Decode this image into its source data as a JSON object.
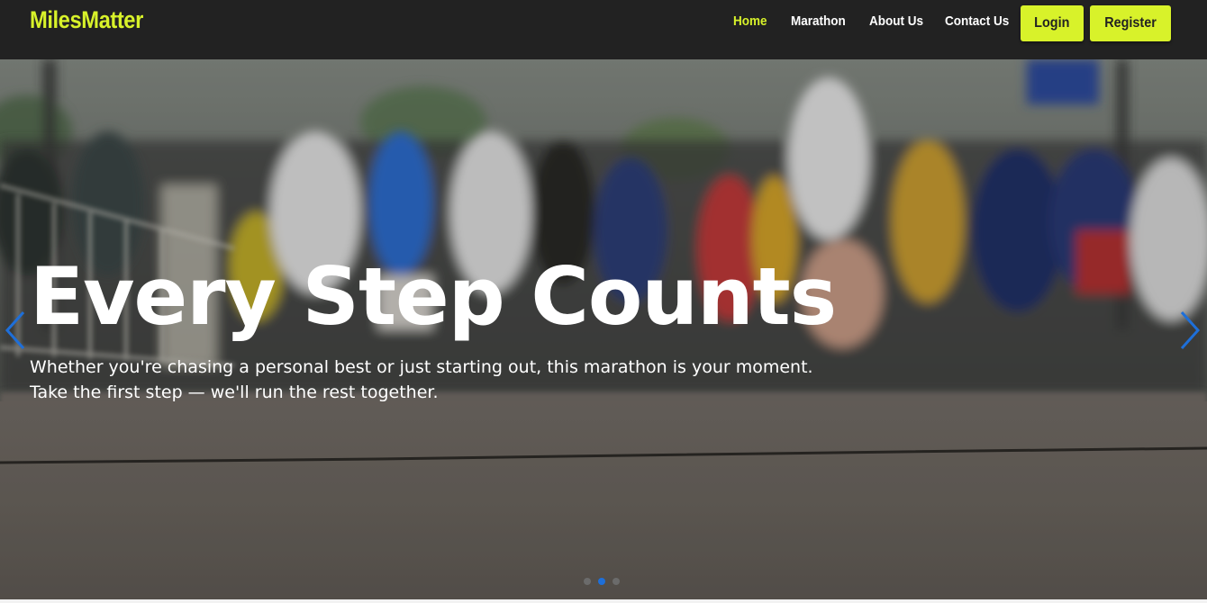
{
  "navbar": {
    "brand": "MilesMatter",
    "links": [
      {
        "label": "Home",
        "active": true
      },
      {
        "label": "Marathon",
        "active": false
      },
      {
        "label": "About Us",
        "active": false
      },
      {
        "label": "Contact Us",
        "active": false
      }
    ],
    "login_label": "Login",
    "register_label": "Register"
  },
  "hero": {
    "title": "Every Step Counts",
    "subtitle_line1": "Whether you're chasing a personal best or just starting out, this marathon is your moment.",
    "subtitle_line2": "Take the first step — we'll run the rest together.",
    "prev_icon": "chevron-left-icon",
    "next_icon": "chevron-right-icon",
    "slides_count": 3,
    "active_slide": 2
  },
  "colors": {
    "accent": "#d8f22a",
    "navbar_bg": "#222222",
    "indicator_active": "#1e6fd9",
    "arrow": "#1e6fd9"
  }
}
